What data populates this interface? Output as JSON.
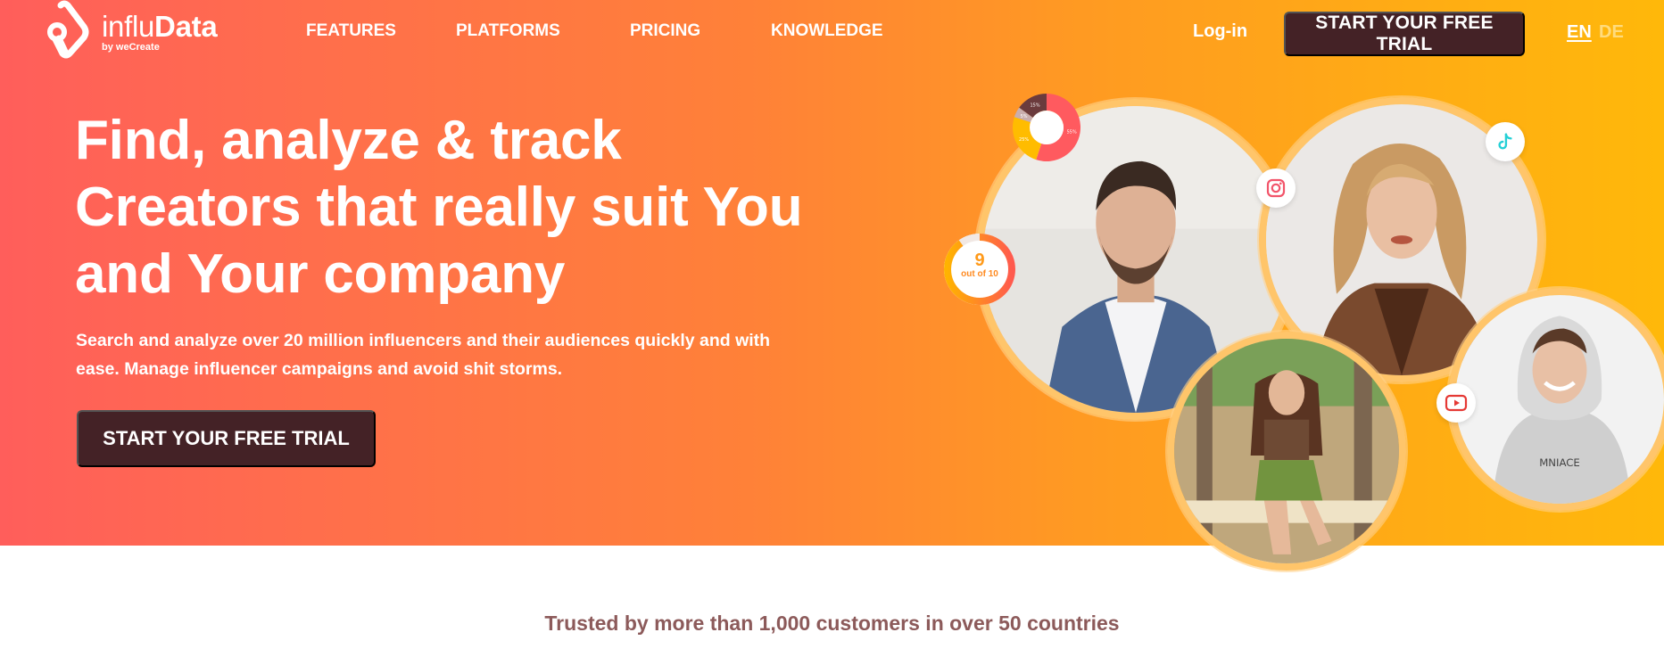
{
  "brand": {
    "name_light": "influ",
    "name_bold": "Data",
    "byline": "by weCreate",
    "icon": "infludata-logo-icon"
  },
  "nav": {
    "items": [
      {
        "label": "FEATURES"
      },
      {
        "label": "PLATFORMS"
      },
      {
        "label": "PRICING"
      },
      {
        "label": "KNOWLEDGE"
      }
    ],
    "login_label": "Log-in",
    "trial_label": "START YOUR FREE TRIAL",
    "languages": [
      {
        "code": "EN",
        "active": true
      },
      {
        "code": "DE",
        "active": false
      }
    ]
  },
  "hero": {
    "headline_lines": [
      "Find, analyze & track",
      "Creators that really suit You",
      "and Your company"
    ],
    "subtitle_lines": [
      "Search and analyze over 20 million influencers and their audiences quickly and with",
      "ease. Manage influencer campaigns and avoid shit storms."
    ],
    "cta_label": "START YOUR FREE TRIAL",
    "donut_widget": {
      "segments": [
        {
          "label": "55%",
          "value": 55,
          "color": "#ff5a5f"
        },
        {
          "label": "25%",
          "value": 25,
          "color": "#ffbc00"
        },
        {
          "label": "5%",
          "value": 5,
          "color": "#c9aeae"
        },
        {
          "label": "15%",
          "value": 15,
          "color": "#6b3b3d"
        }
      ]
    },
    "score_widget": {
      "score": "9",
      "caption": "out of 10",
      "fraction": 0.9
    },
    "platform_badges": [
      {
        "icon": "instagram-icon",
        "color": "#f2546a"
      },
      {
        "icon": "tiktok-icon",
        "color": "#25d0d6"
      },
      {
        "icon": "youtube-icon",
        "color": "#e53935"
      }
    ],
    "creator_photos": [
      {
        "description": "Man in blue blazer"
      },
      {
        "description": "Blonde woman"
      },
      {
        "description": "Young woman in green shorts"
      },
      {
        "description": "Young man in grey hoodie"
      }
    ]
  },
  "trust": {
    "text": "Trusted by more than 1,000 customers in over 50 countries"
  },
  "colors": {
    "gradient_start": "#ff5e5b",
    "gradient_end": "#ffb80a",
    "button_dark": "#442226",
    "trust_text": "#8c5a5a"
  }
}
